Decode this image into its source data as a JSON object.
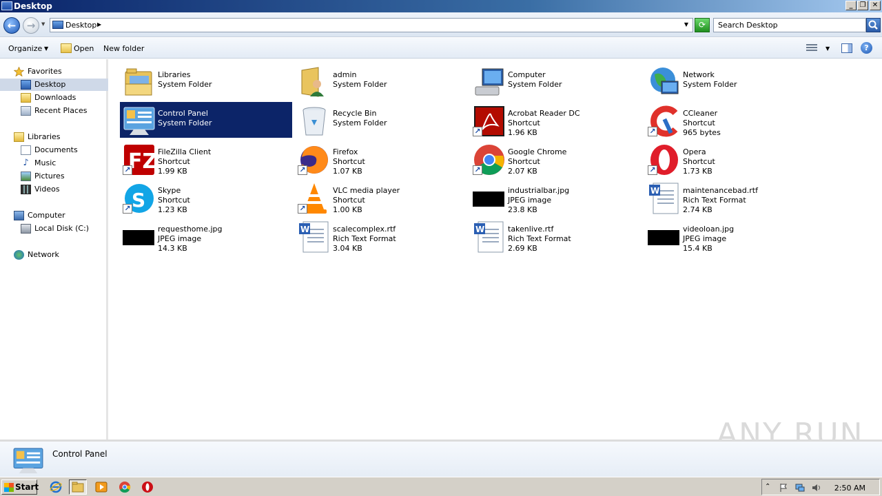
{
  "window": {
    "title": "Desktop"
  },
  "address": {
    "location": "Desktop",
    "search_placeholder": "Search Desktop"
  },
  "command_bar": {
    "organize": "Organize",
    "open": "Open",
    "new_folder": "New folder"
  },
  "nav": {
    "favorites": "Favorites",
    "desktop": "Desktop",
    "downloads": "Downloads",
    "recent_places": "Recent Places",
    "libraries": "Libraries",
    "documents": "Documents",
    "music": "Music",
    "pictures": "Pictures",
    "videos": "Videos",
    "computer": "Computer",
    "local_disk": "Local Disk (C:)",
    "network": "Network"
  },
  "items": [
    {
      "name": "Libraries",
      "type": "System Folder",
      "size": "",
      "icon": "libraries-icon"
    },
    {
      "name": "admin",
      "type": "System Folder",
      "size": "",
      "icon": "user-folder-icon"
    },
    {
      "name": "Computer",
      "type": "System Folder",
      "size": "",
      "icon": "computer-icon"
    },
    {
      "name": "Network",
      "type": "System Folder",
      "size": "",
      "icon": "network-icon"
    },
    {
      "name": "Control Panel",
      "type": "System Folder",
      "size": "",
      "icon": "control-panel-icon"
    },
    {
      "name": "Recycle Bin",
      "type": "System Folder",
      "size": "",
      "icon": "recycle-bin-icon"
    },
    {
      "name": "Acrobat Reader DC",
      "type": "Shortcut",
      "size": "1.96 KB",
      "icon": "acrobat-icon"
    },
    {
      "name": "CCleaner",
      "type": "Shortcut",
      "size": "965 bytes",
      "icon": "ccleaner-icon"
    },
    {
      "name": "FileZilla Client",
      "type": "Shortcut",
      "size": "1.99 KB",
      "icon": "filezilla-icon"
    },
    {
      "name": "Firefox",
      "type": "Shortcut",
      "size": "1.07 KB",
      "icon": "firefox-icon"
    },
    {
      "name": "Google Chrome",
      "type": "Shortcut",
      "size": "2.07 KB",
      "icon": "chrome-icon"
    },
    {
      "name": "Opera",
      "type": "Shortcut",
      "size": "1.73 KB",
      "icon": "opera-icon"
    },
    {
      "name": "Skype",
      "type": "Shortcut",
      "size": "1.23 KB",
      "icon": "skype-icon"
    },
    {
      "name": "VLC media player",
      "type": "Shortcut",
      "size": "1.00 KB",
      "icon": "vlc-icon"
    },
    {
      "name": "industrialbar.jpg",
      "type": "JPEG image",
      "size": "23.8 KB",
      "icon": "jpeg-thumbnail-icon"
    },
    {
      "name": "maintenancebad.rtf",
      "type": "Rich Text Format",
      "size": "2.74 KB",
      "icon": "rtf-document-icon"
    },
    {
      "name": "requesthome.jpg",
      "type": "JPEG image",
      "size": "14.3 KB",
      "icon": "jpeg-thumbnail-icon"
    },
    {
      "name": "scalecomplex.rtf",
      "type": "Rich Text Format",
      "size": "3.04 KB",
      "icon": "rtf-document-icon"
    },
    {
      "name": "takenlive.rtf",
      "type": "Rich Text Format",
      "size": "2.69 KB",
      "icon": "rtf-document-icon"
    },
    {
      "name": "videoloan.jpg",
      "type": "JPEG image",
      "size": "15.4 KB",
      "icon": "jpeg-thumbnail-icon"
    }
  ],
  "details": {
    "selected_name": "Control Panel"
  },
  "taskbar": {
    "start": "Start",
    "clock": "2:50 AM"
  },
  "watermark": "ANY RUN",
  "colors": {
    "selection": "#0c2468",
    "titlebar": "#0a246a",
    "taskbar": "#d4d0c8"
  }
}
